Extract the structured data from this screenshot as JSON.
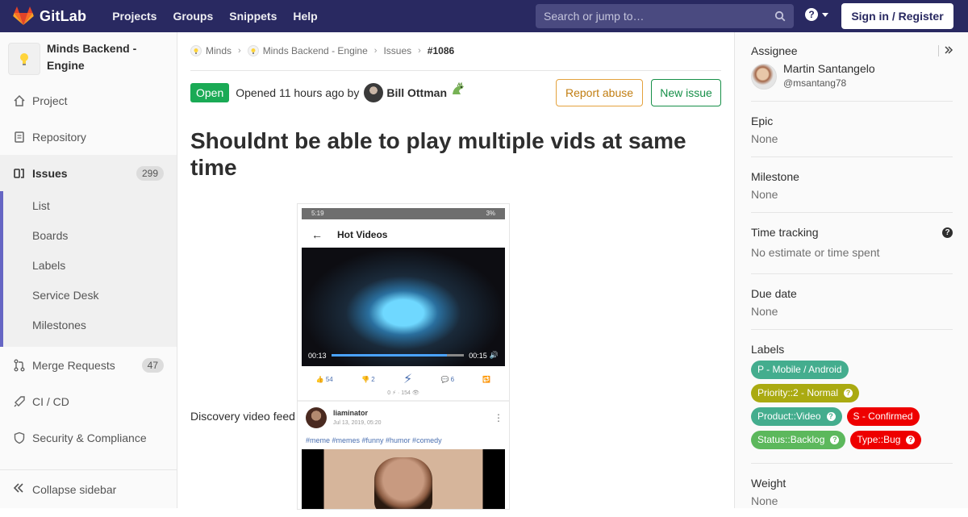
{
  "navbar": {
    "brand": "GitLab",
    "links": [
      "Projects",
      "Groups",
      "Snippets",
      "Help"
    ],
    "search_placeholder": "Search or jump to…",
    "signin": "Sign in / Register",
    "colors": {
      "background": "#292961",
      "search": "#4a4a80"
    }
  },
  "sidebar": {
    "project_name": "Minds Backend - Engine",
    "items": [
      {
        "label": "Project",
        "icon": "home-icon"
      },
      {
        "label": "Repository",
        "icon": "doc-icon"
      },
      {
        "label": "Issues",
        "icon": "issues-icon",
        "badge": "299",
        "active": true
      },
      {
        "label": "Merge Requests",
        "icon": "merge-request-icon",
        "badge": "47"
      },
      {
        "label": "CI / CD",
        "icon": "rocket-icon"
      },
      {
        "label": "Security & Compliance",
        "icon": "shield-icon"
      }
    ],
    "issues_sub": [
      "List",
      "Boards",
      "Labels",
      "Service Desk",
      "Milestones"
    ],
    "collapse_label": "Collapse sidebar",
    "accent": "#6666c4"
  },
  "breadcrumb": {
    "items": [
      "Minds",
      "Minds Backend - Engine",
      "Issues"
    ],
    "current": "#1086"
  },
  "issue": {
    "status": "Open",
    "opened": "Opened 11 hours ago by",
    "author": "Bill Ottman",
    "report_abuse": "Report abuse",
    "new_issue": "New issue",
    "title": "Shouldnt be able to play multiple vids at same time",
    "description": "Discovery video feed",
    "colors": {
      "open": "#1aaa55",
      "abuse": "#e4a23d",
      "new": "#168f48"
    }
  },
  "screenshot": {
    "time": "5:19",
    "battery": "3%",
    "header": "Hot Videos",
    "elapsed": "00:13",
    "duration": "00:15",
    "progress": 0.87,
    "up": "54",
    "down": "2",
    "comments": "6",
    "views": "0 ⚡ · 154 👁",
    "post_user": "liaminator",
    "post_date": "Jul 13, 2019, 05:20",
    "tags": "#meme #memes #funny #humor #comedy"
  },
  "right_sidebar": {
    "assignee_title": "Assignee",
    "assignee_name": "Martin Santangelo",
    "assignee_handle": "@msantang78",
    "epic_title": "Epic",
    "epic_value": "None",
    "milestone_title": "Milestone",
    "milestone_value": "None",
    "time_title": "Time tracking",
    "time_value": "No estimate or time spent",
    "due_title": "Due date",
    "due_value": "None",
    "labels_title": "Labels",
    "labels": [
      {
        "text": "P - Mobile / Android",
        "color": "#44ad8e",
        "scoped": false
      },
      {
        "text": "Priority::2 - Normal",
        "color": "#aaaa11",
        "scoped": true
      },
      {
        "text": "Product::Video",
        "color": "#44ad8e",
        "scoped": true
      },
      {
        "text": "S - Confirmed",
        "color": "#ee0000",
        "scoped": false
      },
      {
        "text": "Status::Backlog",
        "color": "#5cb85c",
        "scoped": true
      },
      {
        "text": "Type::Bug",
        "color": "#ee0000",
        "scoped": true
      }
    ],
    "weight_title": "Weight",
    "weight_value": "None"
  }
}
